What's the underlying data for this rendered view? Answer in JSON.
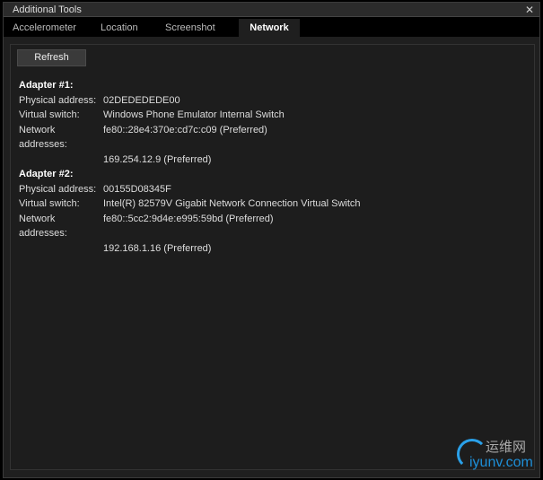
{
  "window": {
    "title": "Additional Tools",
    "close_icon": "close-icon"
  },
  "tabs": [
    {
      "label": "Accelerometer"
    },
    {
      "label": "Location"
    },
    {
      "label": "Screenshot"
    },
    {
      "label": "Network",
      "active": true
    }
  ],
  "toolbar": {
    "refresh_label": "Refresh"
  },
  "adapters": [
    {
      "heading": "Adapter #1:",
      "physical_label": "Physical address:",
      "physical": "02DEDEDEDE00",
      "switch_label": "Virtual switch:",
      "switch": "Windows Phone Emulator Internal Switch",
      "net_label": "Network addresses:",
      "addresses": [
        "fe80::28e4:370e:cd7c:c09 (Preferred)",
        "169.254.12.9 (Preferred)"
      ]
    },
    {
      "heading": "Adapter #2:",
      "physical_label": "Physical address:",
      "physical": "00155D08345F",
      "switch_label": "Virtual switch:",
      "switch": "Intel(R) 82579V Gigabit Network Connection Virtual Switch",
      "net_label": "Network addresses:",
      "addresses": [
        "fe80::5cc2:9d4e:e995:59bd (Preferred)",
        "192.168.1.16 (Preferred)"
      ]
    }
  ],
  "watermark": {
    "cn": "运维网",
    "en": "iyunv.com"
  }
}
